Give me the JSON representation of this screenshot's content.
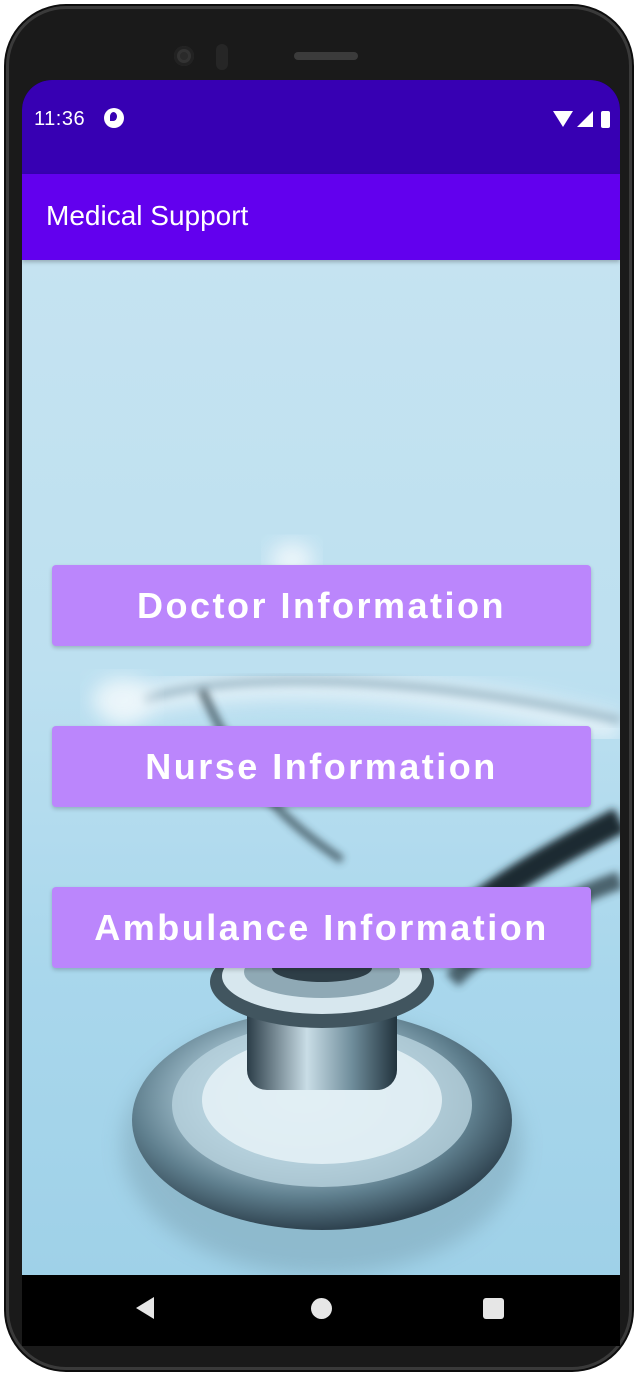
{
  "status_bar": {
    "time": "11:36",
    "icons": [
      "app-notification-icon",
      "wifi-icon",
      "signal-icon",
      "battery-icon"
    ]
  },
  "app_bar": {
    "title": "Medical Support"
  },
  "buttons": {
    "doctor": "Doctor Information",
    "nurse": "Nurse Information",
    "ambulance": "Ambulance Information"
  },
  "nav_bar": {
    "icons": [
      "back-icon",
      "home-icon",
      "recents-icon"
    ]
  },
  "colors": {
    "status_bar": "#3700b3",
    "app_bar": "#6200ee",
    "button": "#bb86fc",
    "button_text": "#ffffff"
  },
  "background": {
    "image": "stethoscope"
  }
}
